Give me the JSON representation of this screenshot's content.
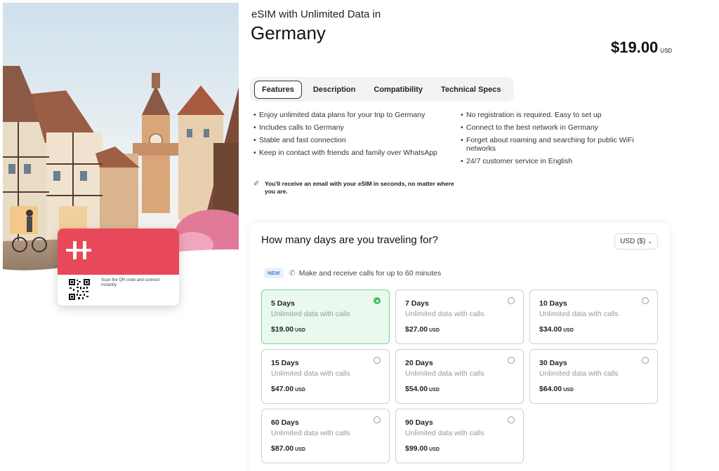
{
  "header": {
    "subtitle": "eSIM with Unlimited Data in",
    "title": "Germany",
    "price": "$19.00",
    "price_currency": "USD"
  },
  "sim_card": {
    "scan_text": "Scan the QR code and connect instantly",
    "brand_color": "#e8495a"
  },
  "tabs": [
    {
      "label": "Features",
      "active": true
    },
    {
      "label": "Description",
      "active": false
    },
    {
      "label": "Compatibility",
      "active": false
    },
    {
      "label": "Technical Specs",
      "active": false
    }
  ],
  "features_left": [
    "Enjoy unlimited data plans for your trip to Germany",
    "Includes calls to Germany",
    "Stable and fast connection",
    "Keep in contact with friends and family over WhatsApp"
  ],
  "features_right": [
    "No registration is required. Easy to set up",
    "Connect to the best network in Germany",
    "Forget about roaming and searching for public WiFi networks",
    "24/7 customer service in English"
  ],
  "email_note": "You'll receive an email with your eSIM in seconds, no matter where you are.",
  "plans_panel": {
    "title": "How many days are you traveling for?",
    "currency_select": "USD ($)",
    "new_badge": "NEW",
    "new_text": "Make and receive calls for up to 60 minutes"
  },
  "plans": [
    {
      "days": "5 Days",
      "desc": "Unlimited data with calls",
      "price": "$19.00",
      "currency": "USD",
      "selected": true
    },
    {
      "days": "7 Days",
      "desc": "Unlimited data with calls",
      "price": "$27.00",
      "currency": "USD",
      "selected": false
    },
    {
      "days": "10 Days",
      "desc": "Unlimited data with calls",
      "price": "$34.00",
      "currency": "USD",
      "selected": false
    },
    {
      "days": "15 Days",
      "desc": "Unlimited data with calls",
      "price": "$47.00",
      "currency": "USD",
      "selected": false
    },
    {
      "days": "20 Days",
      "desc": "Unlimited data with calls",
      "price": "$54.00",
      "currency": "USD",
      "selected": false
    },
    {
      "days": "30 Days",
      "desc": "Unlimited data with calls",
      "price": "$64.00",
      "currency": "USD",
      "selected": false
    },
    {
      "days": "60 Days",
      "desc": "Unlimited data with calls",
      "price": "$87.00",
      "currency": "USD",
      "selected": false
    },
    {
      "days": "90 Days",
      "desc": "Unlimited data with calls",
      "price": "$99.00",
      "currency": "USD",
      "selected": false
    }
  ],
  "colors": {
    "selected_plan_bg": "#e9f9ee",
    "selected_radio": "#3fc26a",
    "new_badge_bg": "#e6f1fb"
  }
}
